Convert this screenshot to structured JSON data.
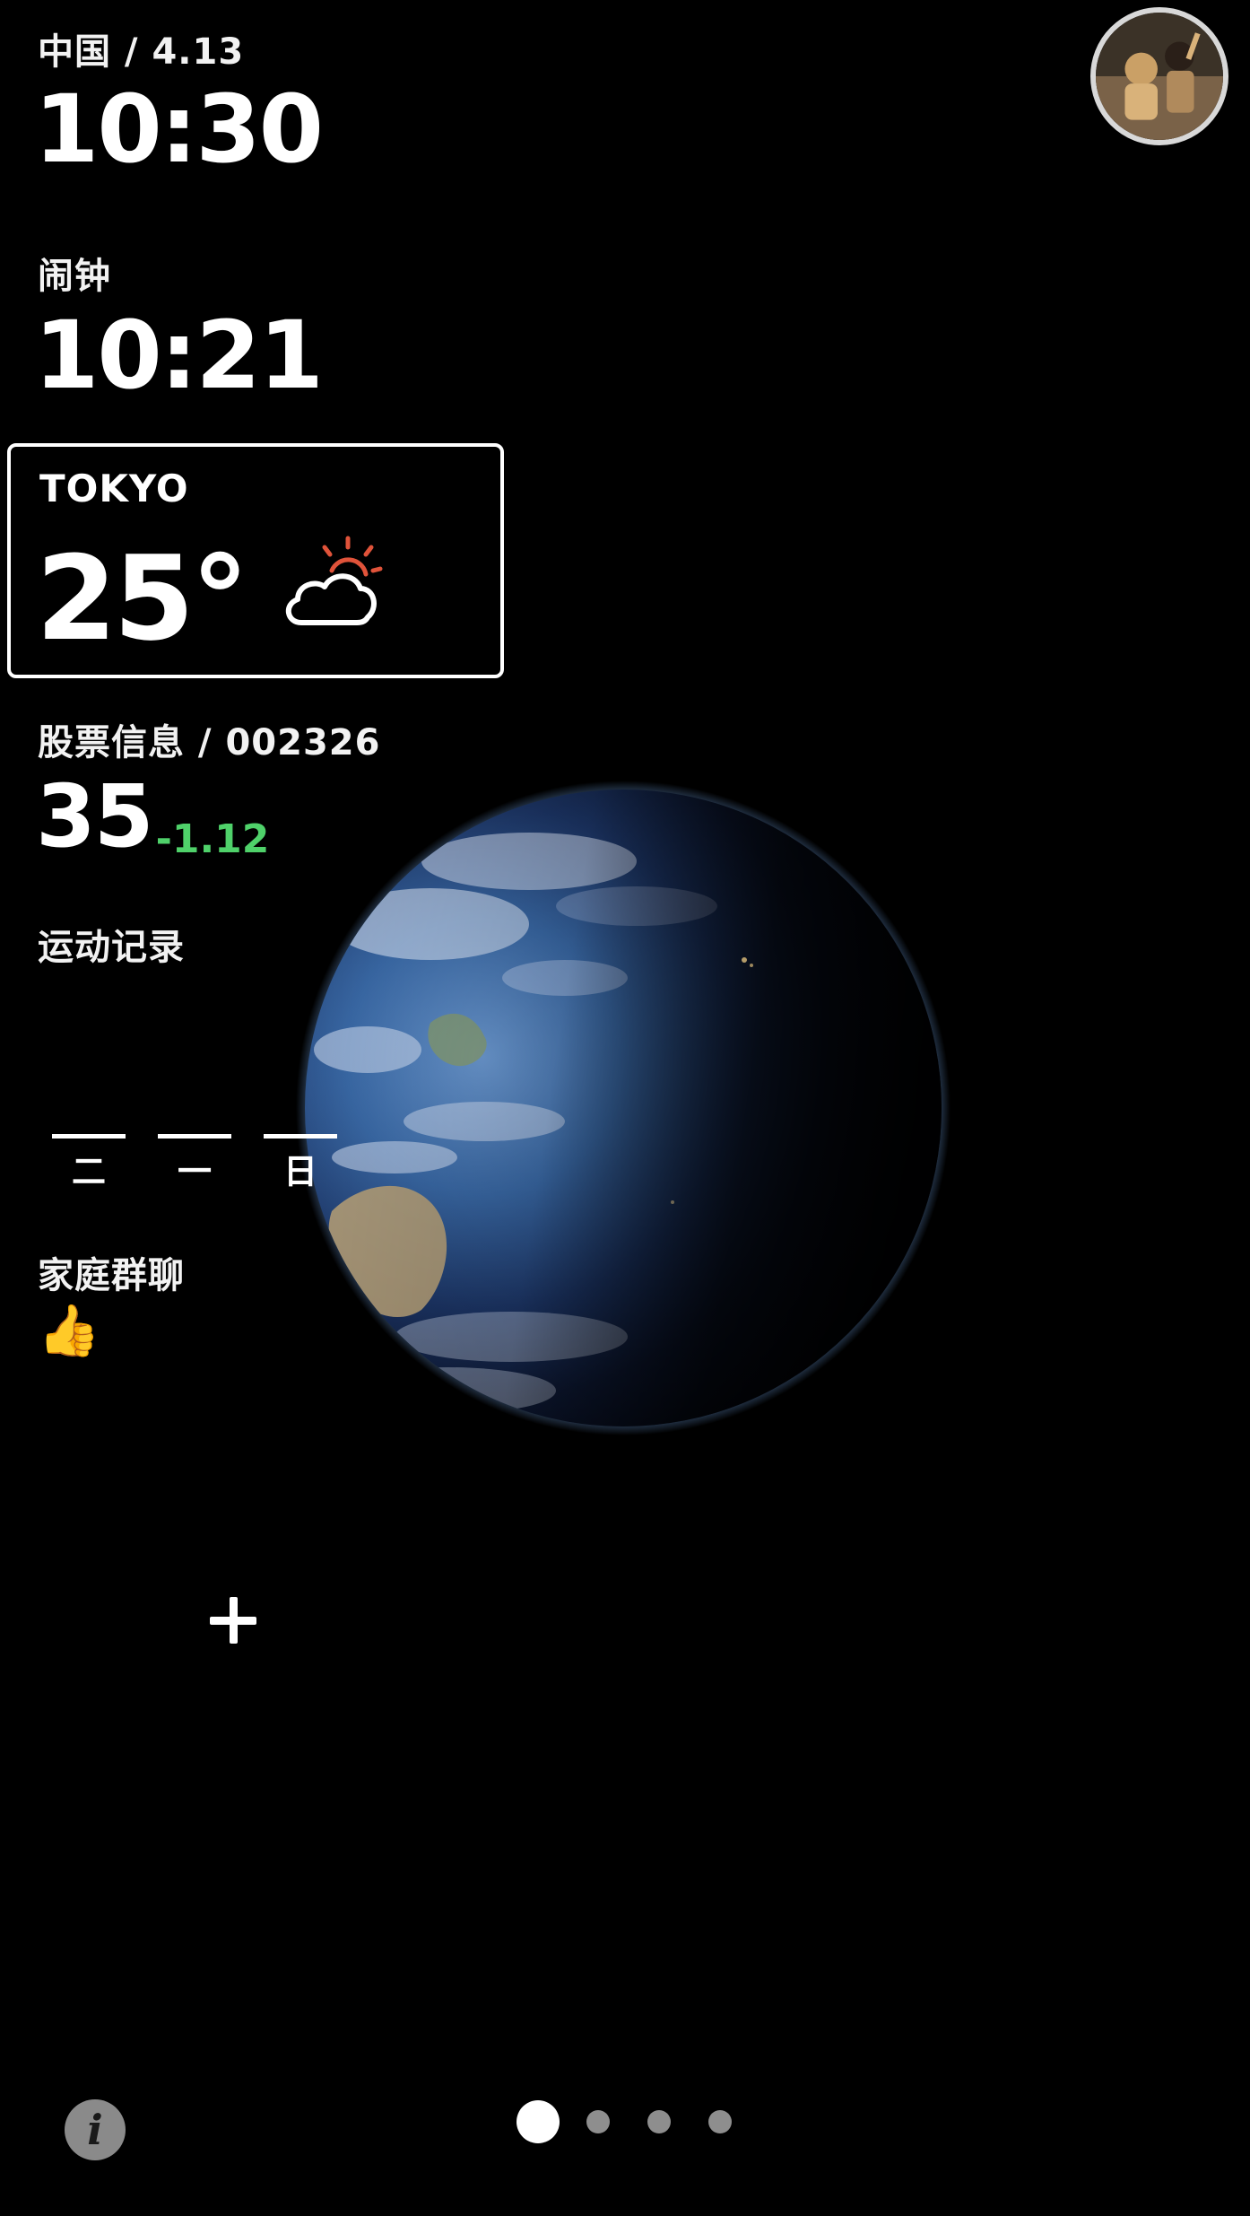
{
  "clock": {
    "region_date": "中国 / 4.13",
    "time": "10:30"
  },
  "alarm": {
    "label": "闹钟",
    "time": "10:21"
  },
  "weather": {
    "city": "TOKYO",
    "temperature": "25°",
    "icon": "partly-sunny-icon",
    "sun_color": "#e0533a"
  },
  "stock": {
    "label": "股票信息 / 002326",
    "price": "35",
    "change": "-1.12",
    "change_color": "#4fd16a"
  },
  "exercise": {
    "label": "运动记录",
    "days": [
      {
        "label": "二"
      },
      {
        "label": "一"
      },
      {
        "label": "日"
      }
    ]
  },
  "family_chat": {
    "label": "家庭群聊",
    "last_message": "👍"
  },
  "controls": {
    "add_icon": "plus-icon",
    "info_label": "i"
  },
  "pager": {
    "count": 4,
    "active_index": 0
  }
}
